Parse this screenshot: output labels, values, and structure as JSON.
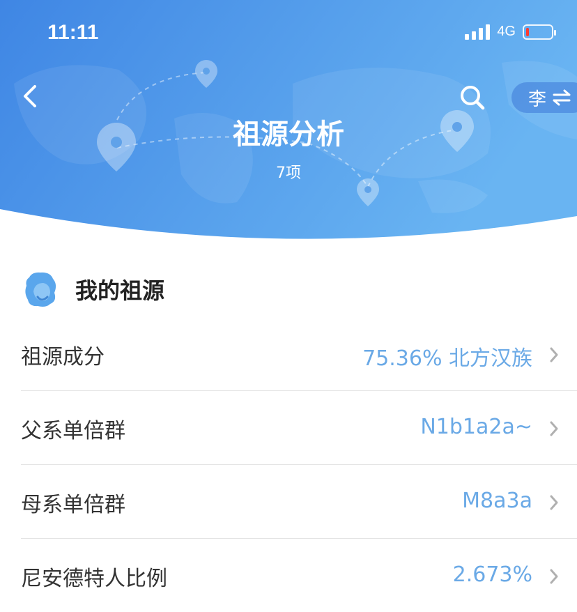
{
  "status_bar": {
    "time": "11:11",
    "network": "4G",
    "battery_level": 0.1
  },
  "header": {
    "title": "祖源分析",
    "subtitle": "7项",
    "surname_button": "李",
    "back_icon": "chevron-left-icon",
    "search_icon": "search-icon",
    "swap_icon": "swap-arrows-icon"
  },
  "section": {
    "title": "我的祖源",
    "icon": "person-silhouette-icon"
  },
  "colors": {
    "header_blue": "#4a90e6",
    "value_blue": "#6aa9e6"
  },
  "rows": [
    {
      "label": "祖源成分",
      "value": "75.36% 北方汉族"
    },
    {
      "label": "父系单倍群",
      "value": "N1b1a2a~"
    },
    {
      "label": "母系单倍群",
      "value": "M8a3a"
    },
    {
      "label": "尼安德特人比例",
      "value": "2.673%"
    }
  ]
}
